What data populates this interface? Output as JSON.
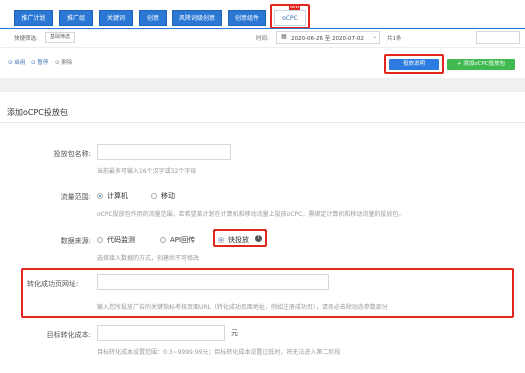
{
  "tabs": [
    {
      "label": "推广计划"
    },
    {
      "label": "推广组"
    },
    {
      "label": "关键词"
    },
    {
      "label": "创意"
    },
    {
      "label": "风降词级创意"
    },
    {
      "label": "创意组件"
    },
    {
      "label": "oCPC",
      "badge": "NEW"
    }
  ],
  "filter": {
    "label": "快捷筛选:",
    "value": "基础筛选",
    "time_label": "时间:",
    "date_range": "2020-06-26 至 2020-07-02",
    "count": "共1条"
  },
  "actions": {
    "enable": "启用",
    "pause": "暂停",
    "delete": "删除",
    "guide_button": "投放说明",
    "add_button": "添加oCPC投放包"
  },
  "form": {
    "section_title": "添加oCPC投放包",
    "name_label": "投放包名称:",
    "name_hint": "当前最多可输入16个汉字或32个字母",
    "traffic_label": "流量范围:",
    "traffic_options": [
      "计算机",
      "移动"
    ],
    "traffic_hint": "oCPC投放包作用的流量范围，若希望某计划在计算机和移动流量上投放oCPC，需绑定计算机和移动流量的投放包。",
    "source_label": "数据来源:",
    "source_options": [
      "代码监测",
      "API回传",
      "快投放"
    ],
    "source_hint": "选择接入数据的方式，创建后不可修改",
    "url_label": "转化成功页网址:",
    "url_hint": "输入您所投放广告的关键指标考核页面URL（转化成功页面地址，例如注册成功页），请务必去除动态参数部分",
    "cost_label": "目标转化成本:",
    "cost_unit": "元",
    "cost_hint": "目标转化成本设置范围：0.3~9999.99元；目标转化成本设置过低时，将无法进入第二阶段"
  },
  "colors": {
    "primary": "#2b7be0",
    "highlight": "#e0261d",
    "success": "#3fb950"
  }
}
